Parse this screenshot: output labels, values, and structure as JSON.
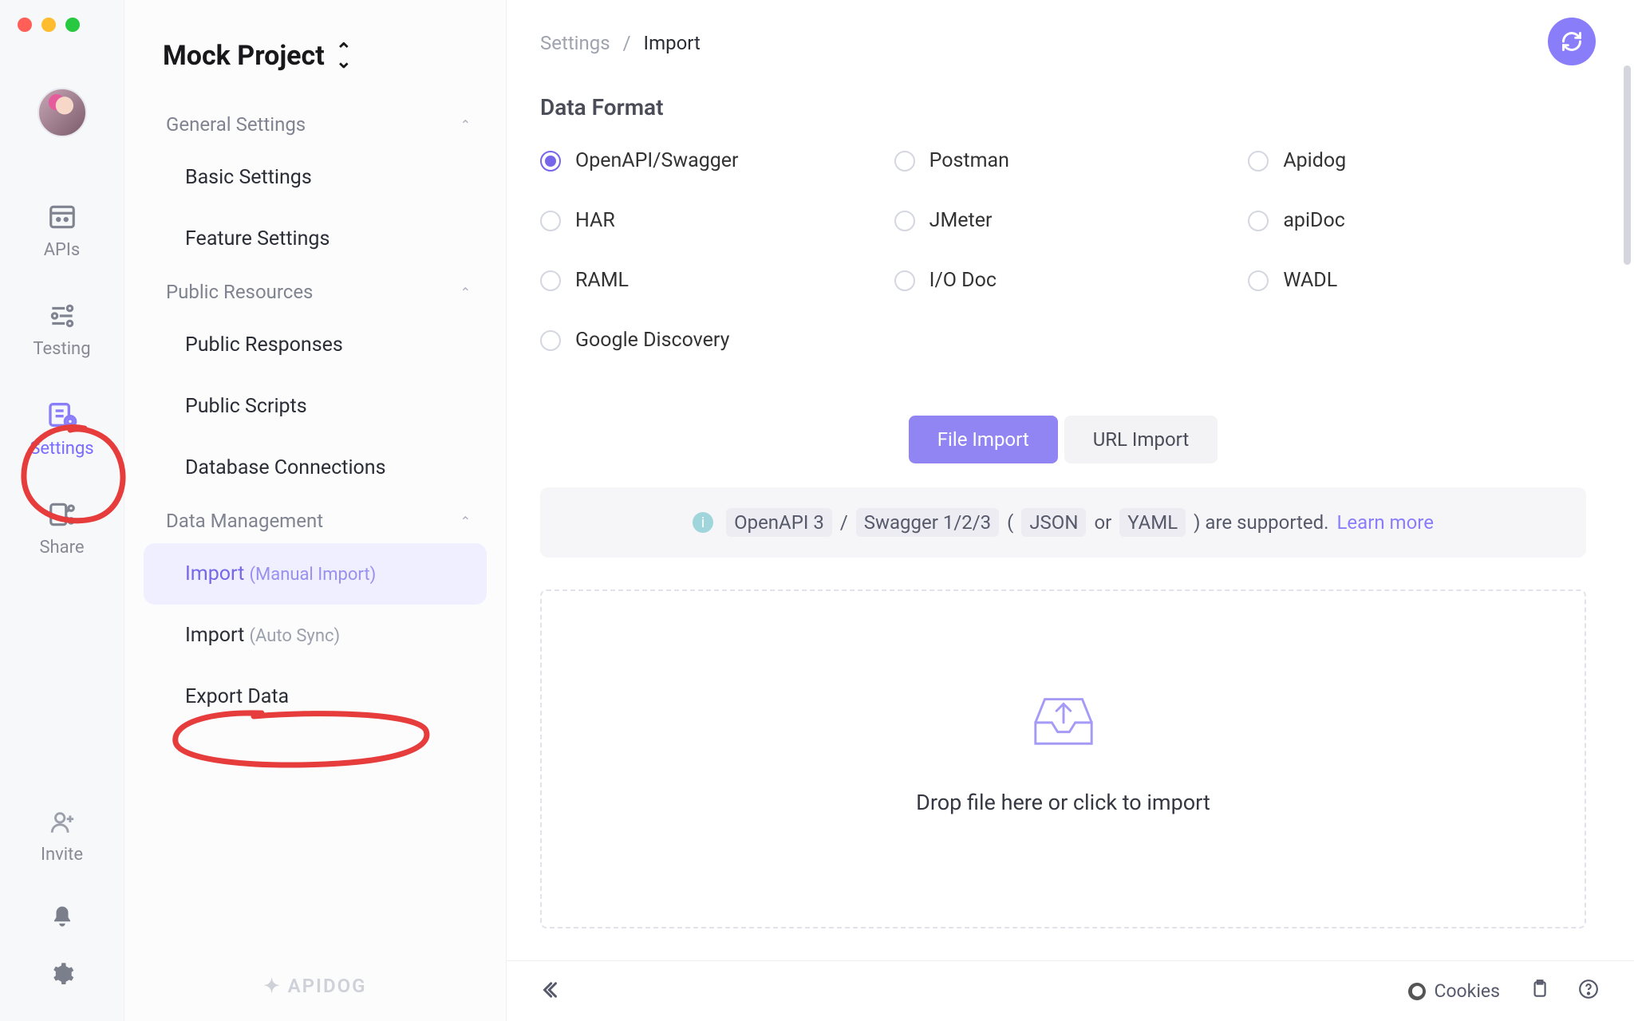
{
  "projectTitle": "Mock Project",
  "rail": {
    "apis": "APIs",
    "testing": "Testing",
    "settings": "Settings",
    "share": "Share",
    "invite": "Invite"
  },
  "sidebar": {
    "general": {
      "header": "General Settings",
      "basic": "Basic Settings",
      "feature": "Feature Settings"
    },
    "public": {
      "header": "Public Resources",
      "responses": "Public Responses",
      "scripts": "Public Scripts",
      "db": "Database Connections"
    },
    "data": {
      "header": "Data Management",
      "importManual": {
        "label": "Import",
        "hint": "(Manual Import)"
      },
      "importAuto": {
        "label": "Import",
        "hint": "(Auto Sync)"
      },
      "export": "Export Data"
    },
    "brand": "APIDOG"
  },
  "breadcrumb": {
    "root": "Settings",
    "sep": "/",
    "current": "Import"
  },
  "main": {
    "dataFormatTitle": "Data Format",
    "formats": {
      "openapi": "OpenAPI/Swagger",
      "postman": "Postman",
      "apidog": "Apidog",
      "har": "HAR",
      "jmeter": "JMeter",
      "apidoc": "apiDoc",
      "raml": "RAML",
      "iodoc": "I/O Doc",
      "wadl": "WADL",
      "google": "Google Discovery"
    },
    "tabs": {
      "file": "File Import",
      "url": "URL Import"
    },
    "info": {
      "chip1": "OpenAPI 3",
      "sl": "/",
      "chip2": "Swagger 1/2/3",
      "lp": "(",
      "chip3": "JSON",
      "or": "or",
      "chip4": "YAML",
      "rp": ") are supported.",
      "link": "Learn more"
    },
    "dropzone": "Drop file here or click to import"
  },
  "bottom": {
    "cookies": "Cookies"
  }
}
